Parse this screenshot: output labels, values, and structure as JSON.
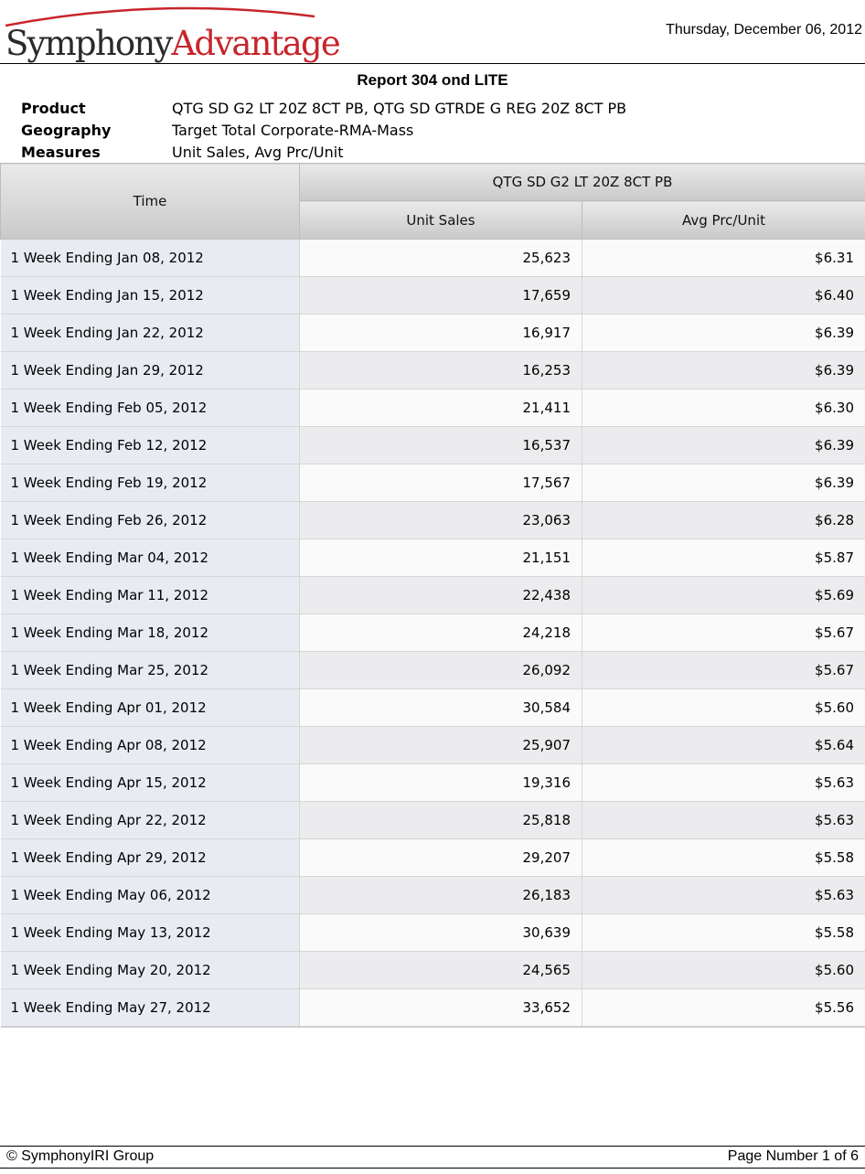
{
  "header": {
    "logo_text_1": "Symphony",
    "logo_text_2": "Advantage",
    "date": "Thursday, December 06, 2012"
  },
  "report": {
    "title": "Report 304 ond LITE"
  },
  "meta": {
    "product_label": "Product",
    "product_value": "QTG SD G2 LT 20Z 8CT PB, QTG SD GTRDE G REG 20Z 8CT PB",
    "geography_label": "Geography",
    "geography_value": "Target Total Corporate-RMA-Mass",
    "measures_label": "Measures",
    "measures_value": "Unit Sales, Avg Prc/Unit"
  },
  "table": {
    "time_header": "Time",
    "group_header": "QTG SD G2 LT 20Z 8CT PB",
    "columns": [
      "Unit Sales",
      "Avg Prc/Unit"
    ],
    "rows": [
      {
        "time": "1 Week Ending Jan 08, 2012",
        "unit_sales": "25,623",
        "avg_price": "$6.31"
      },
      {
        "time": "1 Week Ending Jan 15, 2012",
        "unit_sales": "17,659",
        "avg_price": "$6.40"
      },
      {
        "time": "1 Week Ending Jan 22, 2012",
        "unit_sales": "16,917",
        "avg_price": "$6.39"
      },
      {
        "time": "1 Week Ending Jan 29, 2012",
        "unit_sales": "16,253",
        "avg_price": "$6.39"
      },
      {
        "time": "1 Week Ending Feb 05, 2012",
        "unit_sales": "21,411",
        "avg_price": "$6.30"
      },
      {
        "time": "1 Week Ending Feb 12, 2012",
        "unit_sales": "16,537",
        "avg_price": "$6.39"
      },
      {
        "time": "1 Week Ending Feb 19, 2012",
        "unit_sales": "17,567",
        "avg_price": "$6.39"
      },
      {
        "time": "1 Week Ending Feb 26, 2012",
        "unit_sales": "23,063",
        "avg_price": "$6.28"
      },
      {
        "time": "1 Week Ending Mar 04, 2012",
        "unit_sales": "21,151",
        "avg_price": "$5.87"
      },
      {
        "time": "1 Week Ending Mar 11, 2012",
        "unit_sales": "22,438",
        "avg_price": "$5.69"
      },
      {
        "time": "1 Week Ending Mar 18, 2012",
        "unit_sales": "24,218",
        "avg_price": "$5.67"
      },
      {
        "time": "1 Week Ending Mar 25, 2012",
        "unit_sales": "26,092",
        "avg_price": "$5.67"
      },
      {
        "time": "1 Week Ending Apr 01, 2012",
        "unit_sales": "30,584",
        "avg_price": "$5.60"
      },
      {
        "time": "1 Week Ending Apr 08, 2012",
        "unit_sales": "25,907",
        "avg_price": "$5.64"
      },
      {
        "time": "1 Week Ending Apr 15, 2012",
        "unit_sales": "19,316",
        "avg_price": "$5.63"
      },
      {
        "time": "1 Week Ending Apr 22, 2012",
        "unit_sales": "25,818",
        "avg_price": "$5.63"
      },
      {
        "time": "1 Week Ending Apr 29, 2012",
        "unit_sales": "29,207",
        "avg_price": "$5.58"
      },
      {
        "time": "1 Week Ending May 06, 2012",
        "unit_sales": "26,183",
        "avg_price": "$5.63"
      },
      {
        "time": "1 Week Ending May 13, 2012",
        "unit_sales": "30,639",
        "avg_price": "$5.58"
      },
      {
        "time": "1 Week Ending May 20, 2012",
        "unit_sales": "24,565",
        "avg_price": "$5.60"
      },
      {
        "time": "1 Week Ending May 27, 2012",
        "unit_sales": "33,652",
        "avg_price": "$5.56"
      }
    ]
  },
  "footer": {
    "copyright": "© SymphonyIRI Group",
    "page_number": "Page Number 1 of 6"
  },
  "colors": {
    "brand_red": "#c7252b",
    "brand_dark": "#2a2a2a",
    "time_cell_bg": "#e8ecf2",
    "header_gradient_top": "#eaeaea",
    "header_gradient_bottom": "#c9c9c9"
  }
}
